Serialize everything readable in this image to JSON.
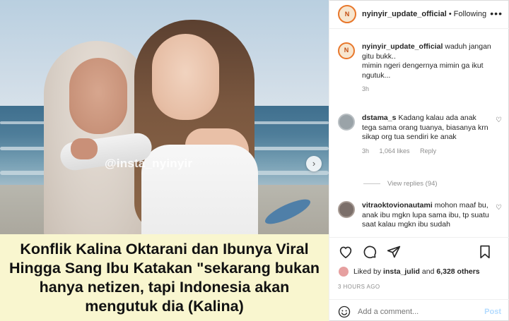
{
  "post": {
    "watermark": "@insta_nyinyir",
    "caption_overlay": "Konflik Kalina Oktarani dan Ibunya Viral Hingga Sang Ibu Katakan \"sekarang bukan hanya netizen, tapi Indonesia akan mengutuk dia (Kalina)"
  },
  "header": {
    "username": "nyinyir_update_official",
    "separator": "•",
    "follow_label": "Following",
    "more_icon": "more-horizontal-icon"
  },
  "comments": [
    {
      "username": "nyinyir_update_official",
      "text": "waduh jangan gitu bukk..\nmimin ngeri dengernya mimin ga ikut ngutuk...",
      "time": "3h"
    },
    {
      "username": "dstama_s",
      "text": "Kadang kalau ada anak tega sama orang tuanya, biasanya krn sikap org tua sendiri ke anak",
      "time": "3h",
      "likes": "1,064 likes",
      "reply_label": "Reply",
      "view_replies": "View replies (94)"
    },
    {
      "username": "vitraoktovionautami",
      "text": "mohon maaf bu, anak ibu mgkn lupa sama ibu, tp suatu saat kalau mgkn ibu sudah"
    }
  ],
  "actions": {
    "like_icon": "heart-icon",
    "comment_icon": "comment-icon",
    "share_icon": "send-icon",
    "save_icon": "bookmark-icon"
  },
  "likes": {
    "prefix": "Liked by",
    "user": "insta_julid",
    "middle": "and",
    "count": "6,328 others"
  },
  "timestamp": "3 HOURS AGO",
  "add_comment": {
    "placeholder": "Add a comment...",
    "post_label": "Post"
  },
  "colors": {
    "caption_bg": "#f9f6cf",
    "link_blue_disabled": "#b3dbff",
    "muted": "#8e8e8e"
  }
}
